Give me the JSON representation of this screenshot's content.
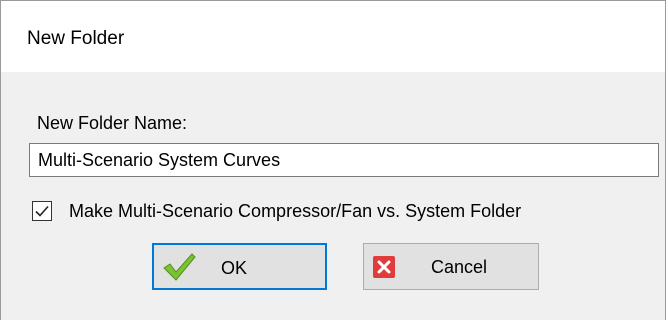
{
  "dialog": {
    "title": "New Folder"
  },
  "folder_name": {
    "label": "New Folder Name:",
    "value": "Multi-Scenario System Curves"
  },
  "system_folder_option": {
    "label": "Make Multi-Scenario Compressor/Fan vs. System Folder",
    "checked": true
  },
  "buttons": {
    "ok_label": "OK",
    "cancel_label": "Cancel"
  },
  "icons": {
    "ok": "green-checkmark-icon",
    "cancel": "red-x-icon",
    "checkbox": "checkmark-icon"
  },
  "colors": {
    "focus_border": "#0078d7",
    "ok_icon": "#7cc331",
    "cancel_icon": "#e03c3c"
  }
}
